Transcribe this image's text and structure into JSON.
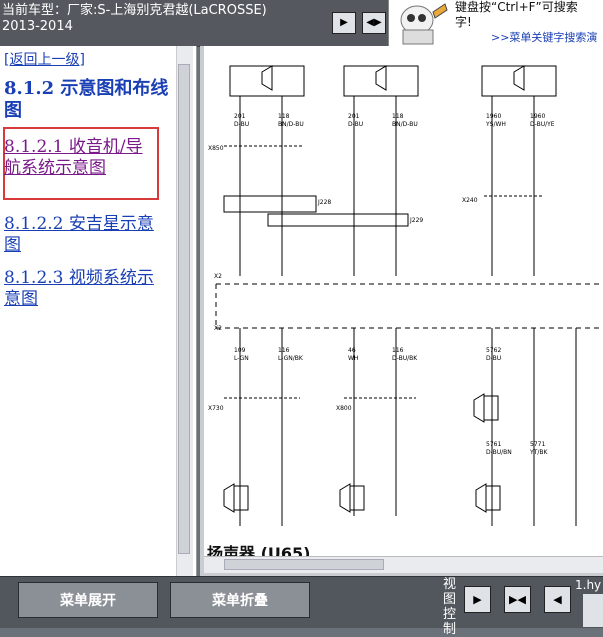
{
  "top": {
    "vehicle_line1": "当前车型：厂家:S-上海别克君越(LaCROSSE)",
    "vehicle_line2": "2013-2014",
    "help_text_line1": "键盘按“Ctrl+F”可搜索",
    "help_text_line2": "字!",
    "help_link": ">>菜单关键字搜索演"
  },
  "sidebar": {
    "back_link": "[返回上一级]",
    "heading": "8.1.2 示意图和布线图",
    "items": [
      {
        "label": "8.1.2.1 收音机/导航系统示意图",
        "active": true
      },
      {
        "label": "8.1.2.2 安吉星示意图",
        "active": false
      },
      {
        "label": "8.1.2.3 视频系统示意图",
        "active": false
      }
    ]
  },
  "diagram": {
    "caption": "扬声器 (U65)",
    "wires": [
      {
        "circuit": "201",
        "color": "D-BU"
      },
      {
        "circuit": "118",
        "color": "BN/D-BU"
      },
      {
        "circuit": "201",
        "color": "D-BU"
      },
      {
        "circuit": "118",
        "color": "BN/D-BU"
      },
      {
        "circuit": "1960",
        "color": "YS/WH"
      },
      {
        "circuit": "1960",
        "color": "D-BU/YE"
      },
      {
        "circuit": "109",
        "color": "L-GN"
      },
      {
        "circuit": "116",
        "color": "L-GN/BK"
      },
      {
        "circuit": "46",
        "color": "WH"
      },
      {
        "circuit": "116",
        "color": "D-BU/BK"
      },
      {
        "circuit": "5762",
        "color": "D-BU"
      },
      {
        "circuit": "5761",
        "color": "D-BU/BN"
      },
      {
        "circuit": "5771",
        "color": "YT/BK"
      }
    ],
    "connectors": [
      "X850",
      "X240",
      "X2",
      "X730",
      "X800"
    ],
    "labels": [
      "J228",
      "J229"
    ]
  },
  "bottom": {
    "expand_button": "菜单展开",
    "collapse_button": "菜单折叠",
    "view_control_label": "视图控制",
    "file_label": "1.hy"
  },
  "colors": {
    "active_outline": "#d83a3a",
    "link": "#1a3fb5"
  }
}
